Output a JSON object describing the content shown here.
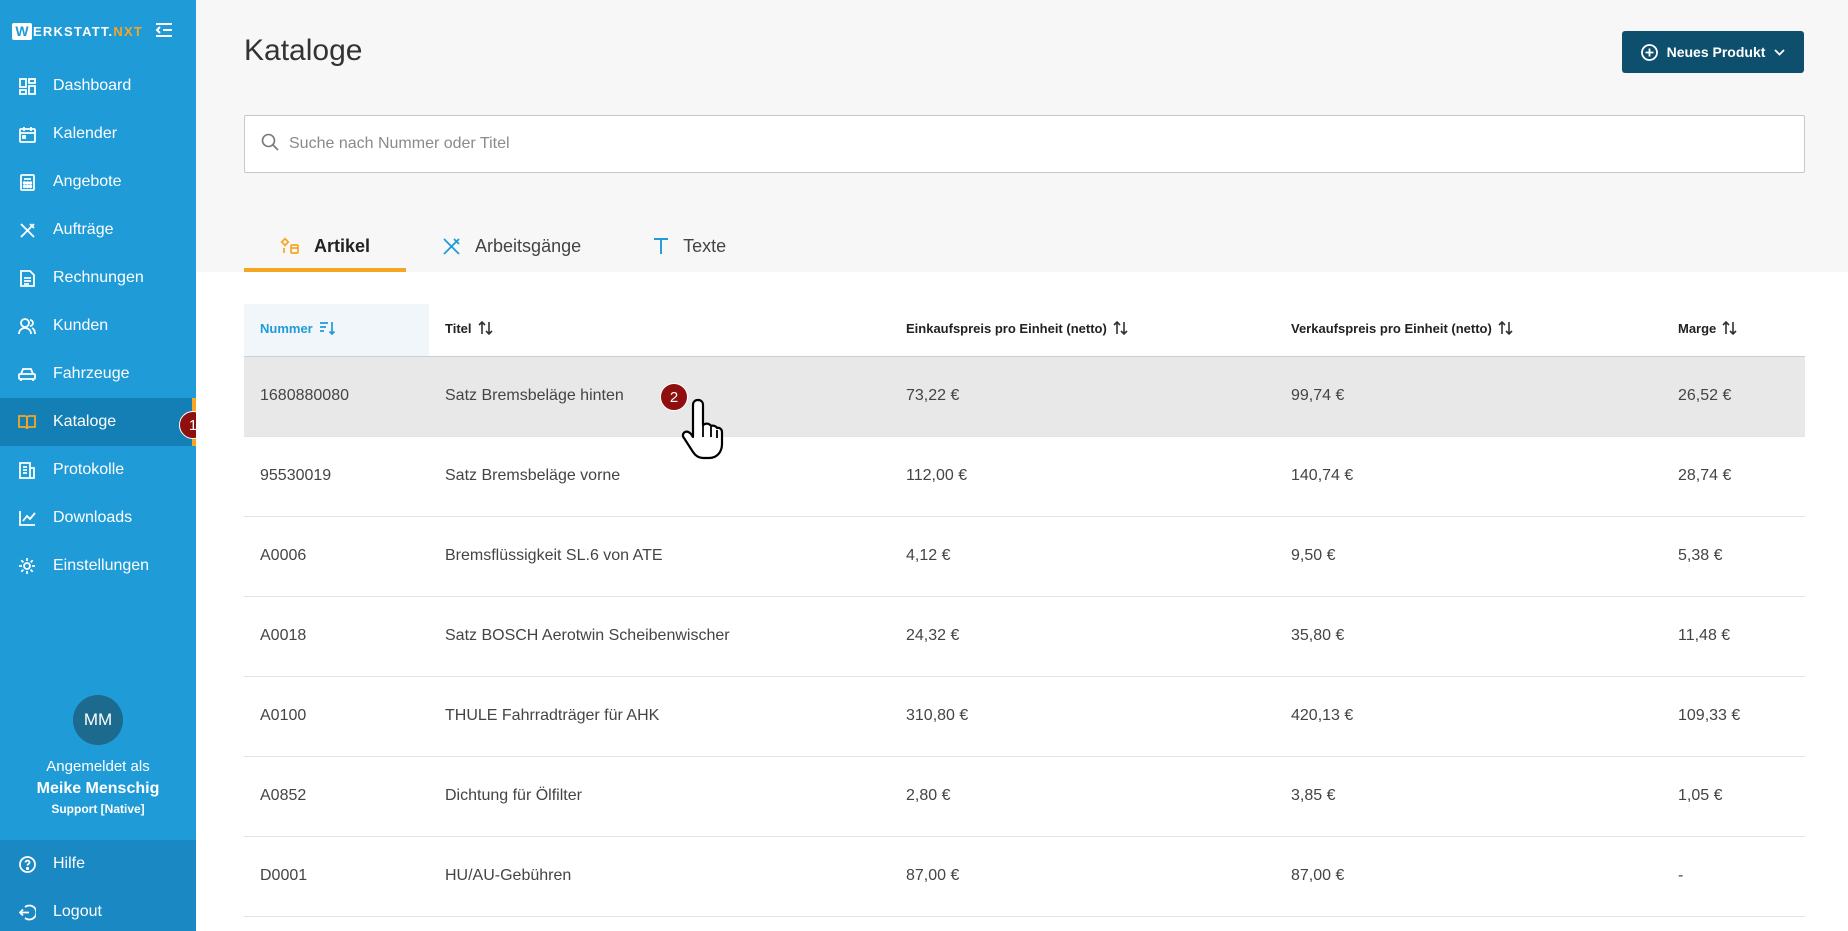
{
  "brand": {
    "initial": "W",
    "name": "ERKSTATT.",
    "accent": "NXT"
  },
  "sidebar": {
    "items": [
      {
        "label": "Dashboard",
        "icon": "dashboard-icon"
      },
      {
        "label": "Kalender",
        "icon": "calendar-icon"
      },
      {
        "label": "Angebote",
        "icon": "calculator-icon"
      },
      {
        "label": "Aufträge",
        "icon": "tools-icon"
      },
      {
        "label": "Rechnungen",
        "icon": "invoice-icon"
      },
      {
        "label": "Kunden",
        "icon": "customers-icon"
      },
      {
        "label": "Fahrzeuge",
        "icon": "car-icon"
      },
      {
        "label": "Kataloge",
        "icon": "book-icon",
        "active": true
      },
      {
        "label": "Protokolle",
        "icon": "protocol-icon"
      },
      {
        "label": "Downloads",
        "icon": "chart-icon"
      },
      {
        "label": "Einstellungen",
        "icon": "gear-icon"
      }
    ],
    "bottom": [
      {
        "label": "Hilfe",
        "icon": "help-icon"
      },
      {
        "label": "Logout",
        "icon": "logout-icon"
      }
    ]
  },
  "user": {
    "initials": "MM",
    "logged_in_label": "Angemeldet als",
    "name": "Meike Menschig",
    "role": "Support [Native]"
  },
  "badges": {
    "step1": "1",
    "step2": "2"
  },
  "page": {
    "title": "Kataloge"
  },
  "new_button": {
    "label": "Neues Produkt"
  },
  "search": {
    "placeholder": "Suche nach Nummer oder Titel"
  },
  "tabs": [
    {
      "label": "Artikel",
      "active": true
    },
    {
      "label": "Arbeitsgänge"
    },
    {
      "label": "Texte"
    }
  ],
  "table": {
    "headers": {
      "nummer": "Nummer",
      "titel": "Titel",
      "einkauf": "Einkaufspreis pro Einheit (netto)",
      "verkauf": "Verkaufspreis pro Einheit (netto)",
      "marge": "Marge"
    },
    "rows": [
      {
        "nummer": "1680880080",
        "titel": "Satz Bremsbeläge hinten",
        "einkauf": "73,22 €",
        "verkauf": "99,74 €",
        "marge": "26,52 €"
      },
      {
        "nummer": "95530019",
        "titel": "Satz Bremsbeläge vorne",
        "einkauf": "112,00 €",
        "verkauf": "140,74 €",
        "marge": "28,74 €"
      },
      {
        "nummer": "A0006",
        "titel": "Bremsflüssigkeit SL.6 von ATE",
        "einkauf": "4,12 €",
        "verkauf": "9,50 €",
        "marge": "5,38 €"
      },
      {
        "nummer": "A0018",
        "titel": "Satz BOSCH Aerotwin Scheibenwischer",
        "einkauf": "24,32 €",
        "verkauf": "35,80 €",
        "marge": "11,48 €"
      },
      {
        "nummer": "A0100",
        "titel": "THULE Fahrradträger für AHK",
        "einkauf": "310,80 €",
        "verkauf": "420,13 €",
        "marge": "109,33 €"
      },
      {
        "nummer": "A0852",
        "titel": "Dichtung für Ölfilter",
        "einkauf": "2,80 €",
        "verkauf": "3,85 €",
        "marge": "1,05 €"
      },
      {
        "nummer": "D0001",
        "titel": "HU/AU-Gebühren",
        "einkauf": "87,00 €",
        "verkauf": "87,00 €",
        "marge": "-"
      }
    ]
  },
  "colors": {
    "sidebar": "#1f9bd8",
    "sidebar_active": "#137fb4",
    "accent": "#f5a623",
    "button": "#0f4f6e",
    "badge": "#8f0e0e"
  }
}
